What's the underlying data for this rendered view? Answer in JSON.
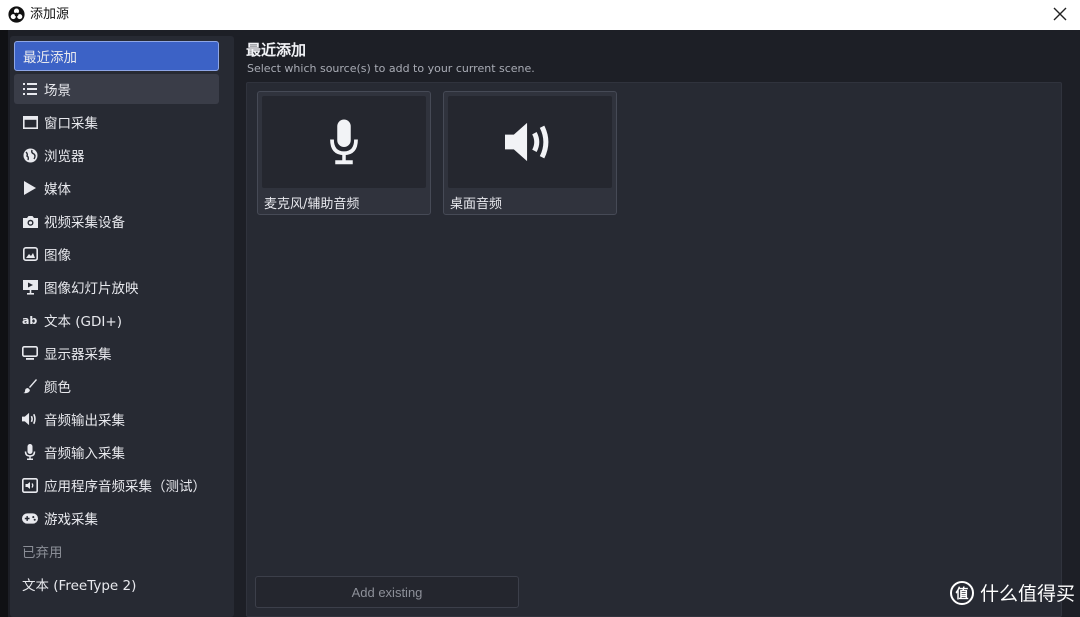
{
  "window": {
    "title": "添加源",
    "close_icon": "close-icon"
  },
  "sidebar": {
    "items": [
      {
        "label": "最近添加",
        "icon": "",
        "state": "active"
      },
      {
        "label": "场景",
        "icon": "list-icon",
        "state": "hover"
      },
      {
        "label": "窗口采集",
        "icon": "window-icon",
        "state": ""
      },
      {
        "label": "浏览器",
        "icon": "globe-icon",
        "state": ""
      },
      {
        "label": "媒体",
        "icon": "play-icon",
        "state": ""
      },
      {
        "label": "视频采集设备",
        "icon": "camera-icon",
        "state": ""
      },
      {
        "label": "图像",
        "icon": "image-icon",
        "state": ""
      },
      {
        "label": "图像幻灯片放映",
        "icon": "slideshow-icon",
        "state": ""
      },
      {
        "label": "文本 (GDI+)",
        "icon": "text-ab-icon",
        "state": ""
      },
      {
        "label": "显示器采集",
        "icon": "monitor-icon",
        "state": ""
      },
      {
        "label": "颜色",
        "icon": "brush-icon",
        "state": ""
      },
      {
        "label": "音频输出采集",
        "icon": "speaker-icon",
        "state": ""
      },
      {
        "label": "音频输入采集",
        "icon": "microphone-icon",
        "state": ""
      },
      {
        "label": "应用程序音频采集（测试）",
        "icon": "app-audio-icon",
        "state": ""
      },
      {
        "label": "游戏采集",
        "icon": "gamepad-icon",
        "state": ""
      },
      {
        "label": "已弃用",
        "icon": "",
        "state": "disabled"
      },
      {
        "label": "文本 (FreeType 2)",
        "icon": "",
        "state": ""
      }
    ]
  },
  "main": {
    "title": "最近添加",
    "subtitle": "Select which source(s) to add to your current scene.",
    "cards": [
      {
        "label": "麦克风/辅助音频",
        "icon": "microphone-icon"
      },
      {
        "label": "桌面音频",
        "icon": "speaker-icon"
      }
    ],
    "add_existing_label": "Add existing"
  },
  "watermark": {
    "text": "什么值得买",
    "icon": "zhi-logo-icon"
  },
  "colors": {
    "accent": "#3c62c6",
    "background": "#1d1f26",
    "panel": "#272a33"
  }
}
